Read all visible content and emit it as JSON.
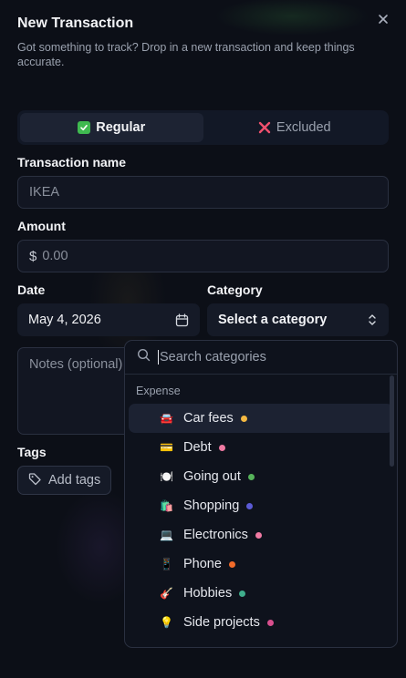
{
  "dialog": {
    "title": "New Transaction",
    "subtitle": "Got something to track? Drop in a new transaction and keep things accurate."
  },
  "type_toggle": {
    "regular_label": "Regular",
    "excluded_label": "Excluded",
    "selected": "Regular"
  },
  "fields": {
    "name_label": "Transaction name",
    "name_placeholder": "IKEA",
    "amount_label": "Amount",
    "amount_prefix": "$",
    "amount_placeholder": "0.00",
    "date_label": "Date",
    "date_value": "May 4, 2026",
    "category_label": "Category",
    "category_value": "Select a category",
    "notes_placeholder": "Notes (optional)",
    "tags_label": "Tags",
    "add_tags_label": "Add tags"
  },
  "category_dropdown": {
    "search_placeholder": "Search categories",
    "group_label": "Expense",
    "items": [
      {
        "label": "Car fees",
        "emoji": "🚘",
        "color": "#f5b942"
      },
      {
        "label": "Debt",
        "emoji": "💳",
        "color": "#f07aa3"
      },
      {
        "label": "Going out",
        "emoji": "🍽️",
        "color": "#56b35a"
      },
      {
        "label": "Shopping",
        "emoji": "🛍️",
        "color": "#5b5bd6"
      },
      {
        "label": "Electronics",
        "emoji": "💻",
        "color": "#f07aa3"
      },
      {
        "label": "Phone",
        "emoji": "📱",
        "color": "#f26b2a"
      },
      {
        "label": "Hobbies",
        "emoji": "🎸",
        "color": "#3fae8c"
      },
      {
        "label": "Side projects",
        "emoji": "💡",
        "color": "#d94f8e"
      }
    ]
  }
}
